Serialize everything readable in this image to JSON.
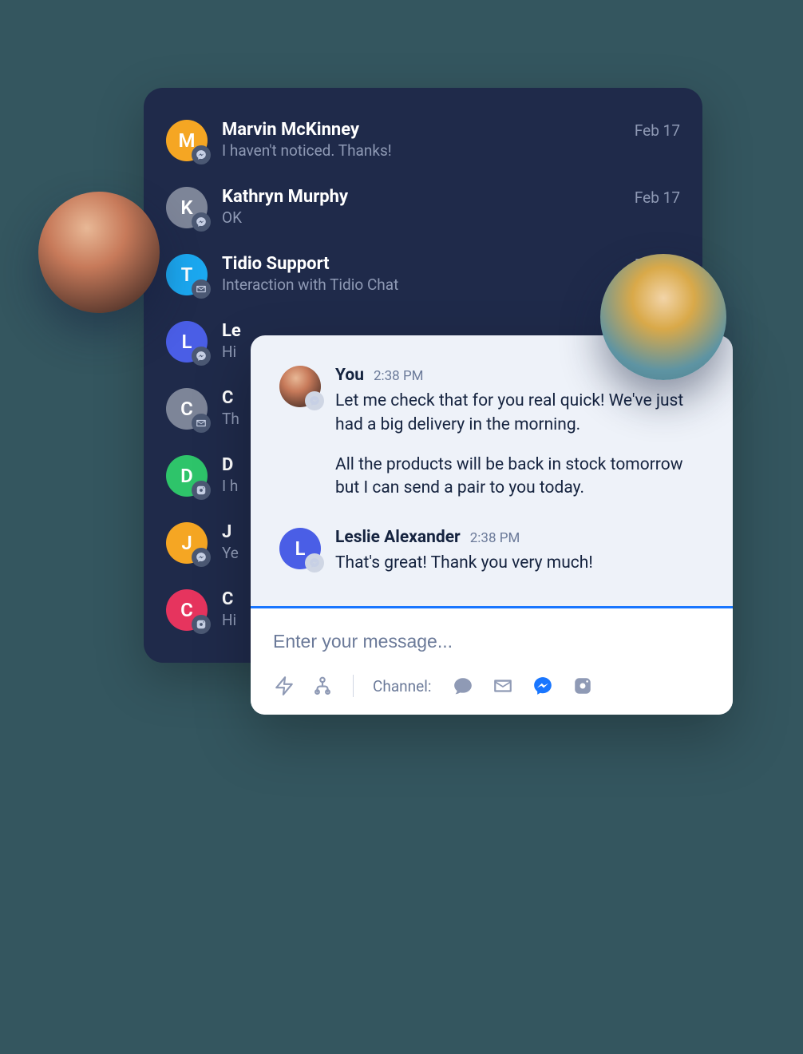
{
  "inbox": {
    "items": [
      {
        "initial": "M",
        "color": "#f5a623",
        "name": "Marvin McKinney",
        "preview": "I haven't noticed. Thanks!",
        "date": "Feb 17",
        "badge": "messenger"
      },
      {
        "initial": "K",
        "color": "#7d8598",
        "name": "Kathryn Murphy",
        "preview": "OK",
        "date": "Feb 17",
        "badge": "messenger"
      },
      {
        "initial": "T",
        "color": "#1ba8f0",
        "name": "Tidio Support",
        "preview": "Interaction with Tidio Chat",
        "date": "Feb 16",
        "badge": "email"
      },
      {
        "initial": "L",
        "color": "#4a5ee6",
        "name": "Le",
        "preview": "Hi",
        "date": "",
        "badge": "messenger"
      },
      {
        "initial": "C",
        "color": "#7d8598",
        "name": "C",
        "preview": "Th",
        "date": "",
        "badge": "email"
      },
      {
        "initial": "D",
        "color": "#2ec46a",
        "name": "D",
        "preview": "I h",
        "date": "",
        "badge": "instagram"
      },
      {
        "initial": "J",
        "color": "#f5a623",
        "name": "J",
        "preview": "Ye",
        "date": "",
        "badge": "messenger"
      },
      {
        "initial": "C",
        "color": "#e6345e",
        "name": "C",
        "preview": "Hi",
        "date": "",
        "badge": "instagram"
      }
    ]
  },
  "chat": {
    "messages": [
      {
        "sender": "You",
        "time": "2:38 PM",
        "avatar_type": "photo",
        "avatar_color": "",
        "avatar_initial": "",
        "badge": "messenger",
        "paragraphs": [
          "Let me check that for you real quick! We've just had a big delivery in the morning.",
          "All the products will be back in stock tomorrow but I can send a pair to you today."
        ]
      },
      {
        "sender": "Leslie Alexander",
        "time": "2:38 PM",
        "avatar_type": "initial",
        "avatar_color": "#4a5ee6",
        "avatar_initial": "L",
        "badge": "messenger",
        "paragraphs": [
          "That's great! Thank you very much!"
        ]
      }
    ],
    "composer": {
      "placeholder": "Enter your message...",
      "channel_label": "Channel:",
      "active_channel": "messenger"
    }
  }
}
